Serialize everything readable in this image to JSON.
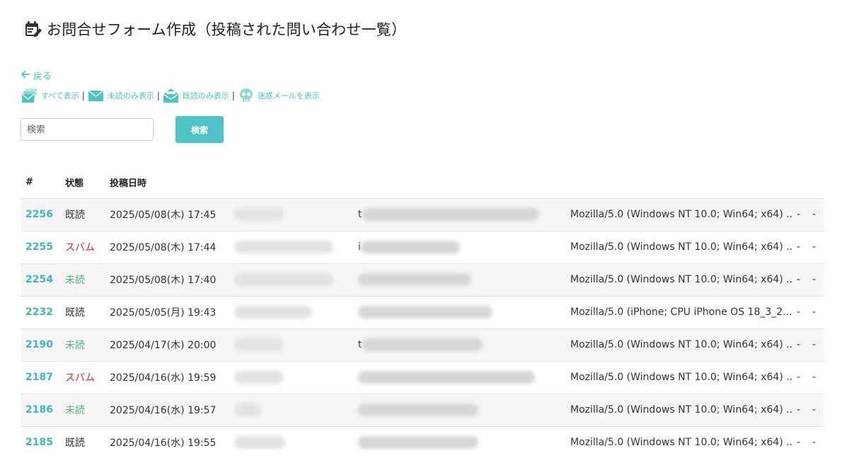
{
  "header": {
    "title": "お問合せフォーム作成（投稿された問い合わせ一覧）",
    "icon": "calendar-edit-icon"
  },
  "nav": {
    "back_label": "戻る"
  },
  "filters": [
    {
      "label": "すべて表示",
      "icon": "mail-stack-icon"
    },
    {
      "label": "未読のみ表示",
      "icon": "mail-closed-icon"
    },
    {
      "label": "既読のみ表示",
      "icon": "mail-open-icon"
    },
    {
      "label": "迷惑メールを表示",
      "icon": "skull-icon"
    }
  ],
  "filter_separator": "|",
  "search": {
    "placeholder": "検索",
    "value": "",
    "button_label": "検索"
  },
  "table": {
    "columns": [
      "#",
      "状態",
      "投稿日時",
      "",
      "",
      "",
      "",
      ""
    ],
    "rows": [
      {
        "id": "2256",
        "status": "既読",
        "status_type": "read",
        "date": "2025/05/08(木) 17:45",
        "name_hidden": true,
        "email_prefix": "t",
        "ua": "Mozilla/5.0 (Windows NT 10.0; Win64; x64) ...",
        "c1": "-",
        "c2": "-"
      },
      {
        "id": "2255",
        "status": "スパム",
        "status_type": "spam",
        "date": "2025/05/08(木) 17:44",
        "name_hidden": true,
        "email_prefix": "i",
        "ua": "Mozilla/5.0 (Windows NT 10.0; Win64; x64) ...",
        "c1": "-",
        "c2": "-"
      },
      {
        "id": "2254",
        "status": "未読",
        "status_type": "unread",
        "date": "2025/05/08(木) 17:40",
        "name_hidden": true,
        "email_prefix": "",
        "ua": "Mozilla/5.0 (Windows NT 10.0; Win64; x64) ...",
        "c1": "-",
        "c2": "-"
      },
      {
        "id": "2232",
        "status": "既読",
        "status_type": "read",
        "date": "2025/05/05(月) 19:43",
        "name_hidden": true,
        "email_prefix": "",
        "ua": "Mozilla/5.0 (iPhone; CPU iPhone OS 18_3_2...",
        "c1": "-",
        "c2": "-"
      },
      {
        "id": "2190",
        "status": "未読",
        "status_type": "unread",
        "date": "2025/04/17(木) 20:00",
        "name_hidden": true,
        "email_prefix": "t",
        "ua": "Mozilla/5.0 (Windows NT 10.0; Win64; x64) ...",
        "c1": "-",
        "c2": "-"
      },
      {
        "id": "2187",
        "status": "スパム",
        "status_type": "spam",
        "date": "2025/04/16(水) 19:59",
        "name_hidden": true,
        "email_prefix": "",
        "ua": "Mozilla/5.0 (Windows NT 10.0; Win64; x64) ...",
        "c1": "-",
        "c2": "-"
      },
      {
        "id": "2186",
        "status": "未読",
        "status_type": "unread",
        "date": "2025/04/16(水) 19:57",
        "name_hidden": true,
        "email_prefix": "",
        "ua": "Mozilla/5.0 (Windows NT 10.0; Win64; x64) ...",
        "c1": "-",
        "c2": "-"
      },
      {
        "id": "2185",
        "status": "既読",
        "status_type": "read",
        "date": "2025/04/16(水) 19:55",
        "name_hidden": true,
        "email_prefix": "",
        "ua": "Mozilla/5.0 (Windows NT 10.0; Win64; x64) ...",
        "c1": "-",
        "c2": "-"
      }
    ]
  },
  "colors": {
    "accent": "#4fc3c8",
    "link": "#3fb6bd",
    "spam": "#e0282e",
    "unread": "#52b87b",
    "row_alt": "#f5f5f5"
  }
}
